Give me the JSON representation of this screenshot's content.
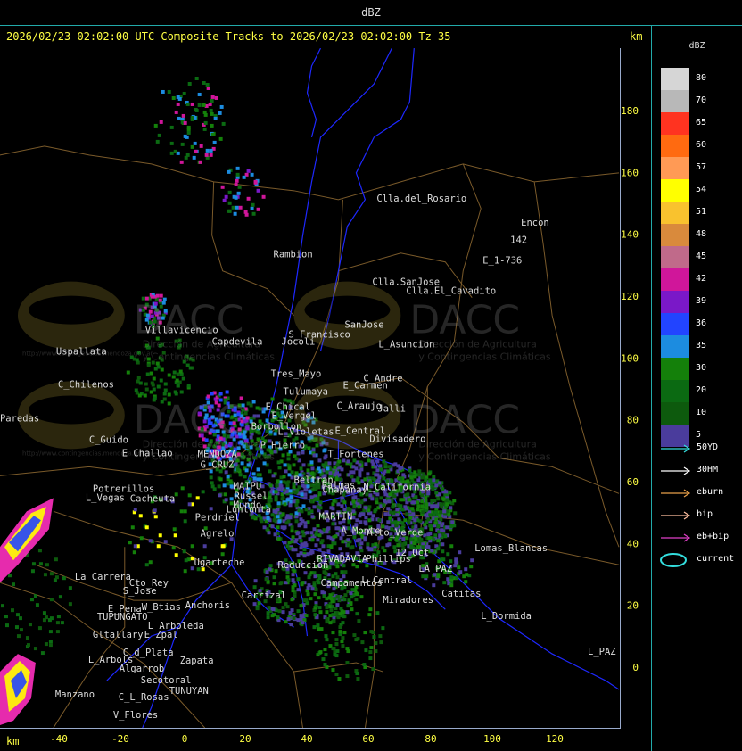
{
  "window": {
    "title": "dBZ"
  },
  "header": {
    "text": "2026/02/23 02:02:00 UTC Composite Tracks to 2026/02/23 02:02:00 Tz 35",
    "unit_top": "km",
    "unit_bottom": "km"
  },
  "axes": {
    "x_ticks": [
      "-40",
      "-20",
      "0",
      "20",
      "40",
      "60",
      "80",
      "100",
      "120"
    ],
    "y_ticks": [
      "180",
      "160",
      "140",
      "120",
      "100",
      "80",
      "60",
      "40",
      "20",
      "0"
    ]
  },
  "watermark": {
    "name": "DACC",
    "line1": "Dirección de Agricultura",
    "line2": "y Contingencias Climáticas",
    "url": "http://www.contingencias.mendoza.gov.ar"
  },
  "places": [
    "Clla.del_Rosario",
    "Encon",
    "142",
    "E_1-736",
    "Rambion",
    "Clla.SanJose",
    "Clla.El_Cavadito",
    "Villavicencio",
    "Capdevila",
    "S_Francisco",
    "SanJose",
    "L_Asuncion",
    "Uspallata",
    "Jocoli",
    "Tres_Mayo",
    "C_Andre",
    "C_Chilenos",
    "Tulumaya",
    "E_Carmen",
    "E_Chical",
    "C_Araujo",
    "Jalli",
    "Paredas",
    "E_Vergel",
    "Borbollon",
    "L_Violetas",
    "E_Central",
    "Divisadero",
    "C_Guido",
    "E_Challao",
    "P_Hierro",
    "T_Fortenes",
    "MENDOZA",
    "G_CRUZ",
    "Beltran",
    "Chapanay",
    "Potrerillos",
    "MAIPU",
    "Palmas",
    "N_California",
    "L_Vegas",
    "Cacheuta",
    "Russel",
    "Mundo",
    "Lunlunta",
    "Perdriel",
    "MARTIN",
    "Agrelo",
    "A_Monte",
    "Alto_Verde",
    "Ugarteche",
    "Reduccion",
    "Lomas_Blancas",
    "12_Oct",
    "La_Carrera",
    "Cto_Rey",
    "S_Jose",
    "RIVADAVIA",
    "Phillips",
    "LA_PAZ",
    "E_Pena",
    "W_Btias",
    "Anchoris",
    "Carrizal",
    "Campamentos",
    "L_Central",
    "Catitas",
    "TUPUNGATO",
    "Miradores",
    "L_Arboleda",
    "L_Dormida",
    "Gltallary",
    "E_Zpal",
    "C_d_Plata",
    "L_Arbols",
    "Zapata",
    "Algarrob",
    "Manzano",
    "Secotoral",
    "TUNUYAN",
    "C_L_Rosas",
    "V_Flores",
    "L_PAZ"
  ],
  "legend": {
    "title": "dBZ",
    "levels": [
      {
        "label": "80",
        "color": "#d6d6d6"
      },
      {
        "label": "70",
        "color": "#b8b8b8"
      },
      {
        "label": "65",
        "color": "#ff3320"
      },
      {
        "label": "60",
        "color": "#ff6a10"
      },
      {
        "label": "57",
        "color": "#ff9a55"
      },
      {
        "label": "54",
        "color": "#ffff00"
      },
      {
        "label": "51",
        "color": "#f9c22e"
      },
      {
        "label": "48",
        "color": "#d98a3c"
      },
      {
        "label": "45",
        "color": "#c06a8a"
      },
      {
        "label": "42",
        "color": "#d0169a"
      },
      {
        "label": "39",
        "color": "#7a18c8"
      },
      {
        "label": "36",
        "color": "#2244ff"
      },
      {
        "label": "35",
        "color": "#1c8ce0"
      },
      {
        "label": "30",
        "color": "#14800a"
      },
      {
        "label": "20",
        "color": "#0b6a12"
      },
      {
        "label": "10",
        "color": "#0d5a0d"
      },
      {
        "label": "5",
        "color": "#4a3c9c"
      }
    ],
    "tracks": [
      {
        "label": "50YD",
        "color": "#33dddd",
        "icon": "arrow-icon"
      },
      {
        "label": "30HM",
        "color": "#ffffff",
        "icon": "arrow-icon"
      },
      {
        "label": "eburn",
        "color": "#e8a04a",
        "icon": "arrow-icon"
      },
      {
        "label": "bip",
        "color": "#ffc0a0",
        "icon": "arrow-icon"
      },
      {
        "label": "eb+bip",
        "color": "#e040c8",
        "icon": "arrow-icon"
      },
      {
        "label": "current",
        "color": "#33dddd",
        "icon": "ellipse-icon"
      }
    ]
  },
  "colors": {
    "frame": "#22aaaa",
    "axis_text": "#ffff44",
    "roads": "#7a5a2a",
    "rivers": "#1e28ff"
  }
}
